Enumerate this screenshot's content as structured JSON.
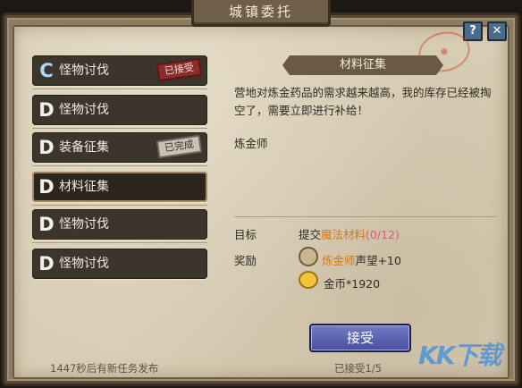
{
  "window": {
    "title": "城镇委托"
  },
  "buttons": {
    "help": "?",
    "close": "✕",
    "accept": "接受"
  },
  "quests": [
    {
      "rank": "C",
      "label": "怪物讨伐",
      "badge": "已接受",
      "badge_style": "red"
    },
    {
      "rank": "D",
      "label": "怪物讨伐",
      "badge": "",
      "badge_style": ""
    },
    {
      "rank": "D",
      "label": "装备征集",
      "badge": "已完成",
      "badge_style": "gray"
    },
    {
      "rank": "D",
      "label": "材料征集",
      "badge": "",
      "badge_style": "",
      "active": true
    },
    {
      "rank": "D",
      "label": "怪物讨伐",
      "badge": "",
      "badge_style": ""
    },
    {
      "rank": "D",
      "label": "怪物讨伐",
      "badge": "",
      "badge_style": ""
    }
  ],
  "detail": {
    "title": "材料征集",
    "description": "营地对炼金药品的需求越来越高，我的库存已经被掏空了，需要立即进行补给！",
    "npc": "炼金师",
    "objective_label": "目标",
    "objective_prefix": "提交",
    "objective_item": "魔法材料",
    "objective_progress": "(0/12)",
    "reward_label": "奖励",
    "reward_rep_name": "炼金师",
    "reward_rep_suffix": "声望+10",
    "reward_gold": "金币*1920"
  },
  "footer": {
    "timer": "1447秒后有新任务发布",
    "accepted_count": "已接受1/5"
  },
  "colors": {
    "highlight_orange": "#d27d18",
    "progress_pink": "#d65f7a",
    "button_blue": "#4a4f9c"
  },
  "icons": {
    "reputation": "reputation-badge-icon",
    "gold": "gold-coin-icon",
    "cursor": "hand-cursor-icon"
  }
}
